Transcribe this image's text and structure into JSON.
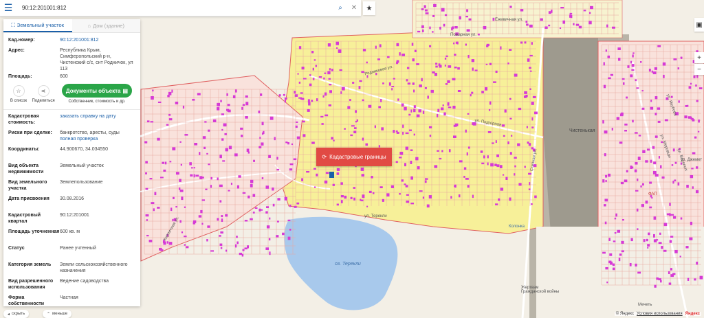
{
  "search": {
    "value": "90:12:201001:812"
  },
  "tabs": [
    {
      "label": "Земельный участок"
    },
    {
      "label": "Дом (здание)"
    }
  ],
  "fields_top": [
    {
      "key": "Кад.номер:",
      "value": "90:12:201001:812",
      "link": true
    },
    {
      "key": "Адрес:",
      "value": "Республика Крым, Симферопольский р-н, Чистенский с/с, снт Родничок, ул 113",
      "link": false
    },
    {
      "key": "Площадь:",
      "value": "600",
      "link": false
    }
  ],
  "actions": {
    "list_label": "В список",
    "share_label": "Поделиться",
    "docs_label": "Документы объекта",
    "docs_sub": "Собственник, стоимость и др."
  },
  "fields_bottom": [
    {
      "key": "Кадастровая стоимость:",
      "value": "заказать справку на дату",
      "link": true
    },
    {
      "key": "Риски при сделке:",
      "value": "банкротство, аресты, суды",
      "extra": "полная проверка"
    },
    {
      "key": "Координаты:",
      "value": "44.900670, 34.034550"
    },
    {
      "key": "Вид объекта недвижимости",
      "value": "Земельный участок"
    },
    {
      "key": "Вид земельного участка",
      "value": "Землепользование"
    },
    {
      "key": "Дата присвоения",
      "value": "30.08.2016"
    },
    {
      "key": "Кадастровый квартал",
      "value": "90:12:201001"
    },
    {
      "key": "Площадь уточненная",
      "value": "600 кв. м"
    },
    {
      "key": "Статус",
      "value": "Ранее учтенный"
    },
    {
      "key": "Категория земель",
      "value": "Земли сельскохозяйственного назначения"
    },
    {
      "key": "Вид разрешенного использования",
      "value": "Ведение садоводства"
    },
    {
      "key": "Форма собственности",
      "value": "Частная"
    }
  ],
  "bottom": {
    "hide_label": "скрыть",
    "less_label": "меньше"
  },
  "map": {
    "cadastre_label": "Кадастровые границы",
    "lake_label": "оз. Терекли",
    "station_label": "Чистенькая",
    "fap_label": "ФАП",
    "kolonka_label": "Колонка",
    "memorial_label": "Жертвам Гражданской войны",
    "mosque_label": "Мечеть",
    "street_labels": [
      "Родниковая ул.",
      "ул. Терекли",
      "Ежевичная ул.",
      "Пожарная ул.",
      "ул. Меровцы",
      "ул. Якубова",
      "ул. Веселых",
      "ул. Джемет",
      "Степная ул.",
      "ул. Подгорная",
      "Кирпичная ул."
    ]
  },
  "copyright": {
    "yandex": "© Яндекс",
    "terms": "Условия использования",
    "brand": "Яндекс"
  },
  "colors": {
    "accent": "#1a5fa8",
    "green": "#2aa548",
    "red": "#e14a44",
    "parcel": "#f7f099",
    "building": "#d63ad6",
    "border": "#e06060",
    "water": "#a8c9ec"
  }
}
